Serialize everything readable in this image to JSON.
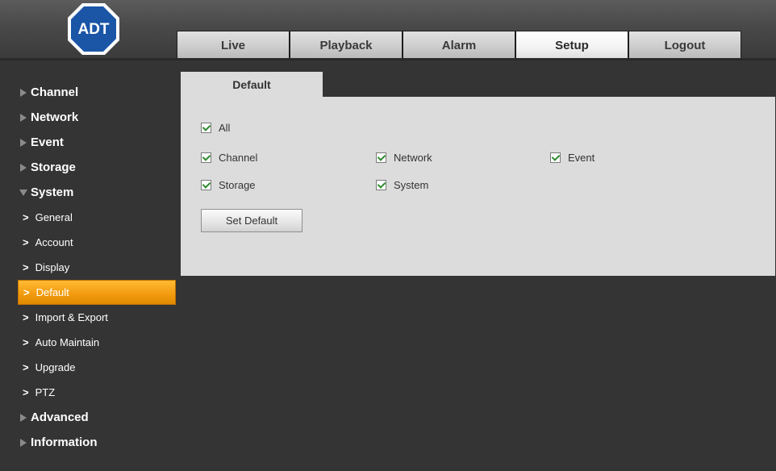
{
  "header": {
    "logo_text": "ADT",
    "tabs": [
      {
        "label": "Live"
      },
      {
        "label": "Playback"
      },
      {
        "label": "Alarm"
      },
      {
        "label": "Setup"
      },
      {
        "label": "Logout"
      }
    ],
    "active_tab": "Setup"
  },
  "sidebar": {
    "top_items": [
      "Channel",
      "Network",
      "Event",
      "Storage",
      "System"
    ],
    "system_sub": [
      "General",
      "Account",
      "Display",
      "Default",
      "Import & Export",
      "Auto Maintain",
      "Upgrade",
      "PTZ"
    ],
    "bottom_items": [
      "Advanced",
      "Information"
    ],
    "active_sub": "Default"
  },
  "content": {
    "tab_label": "Default",
    "checkboxes": {
      "all": "All",
      "channel": "Channel",
      "network": "Network",
      "event": "Event",
      "storage": "Storage",
      "system": "System"
    },
    "checked": true,
    "button_label": "Set Default"
  },
  "colors": {
    "background": "#343434",
    "active_item": "#f39c12",
    "panel": "#dcdcdc",
    "check": "#2e8b2e"
  }
}
